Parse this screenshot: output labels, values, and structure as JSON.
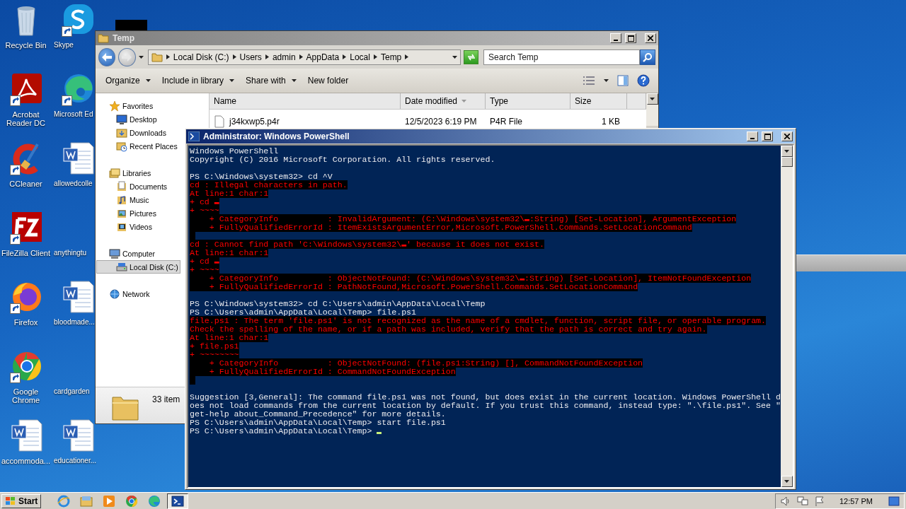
{
  "desktop_icons": [
    {
      "label": "Recycle Bin",
      "kind": "recycle"
    },
    {
      "label": "Skype",
      "kind": "skype",
      "shortcut": true
    },
    {
      "label": "Acrobat Reader DC",
      "kind": "acrobat",
      "shortcut": true
    },
    {
      "label": "Microsoft Ed",
      "kind": "edge",
      "shortcut": true
    },
    {
      "label": "CCleaner",
      "kind": "ccleaner",
      "shortcut": true
    },
    {
      "label": "allowedcolle",
      "kind": "word"
    },
    {
      "label": "FileZilla Client",
      "kind": "filezilla",
      "shortcut": true
    },
    {
      "label": "anythingtu",
      "kind": "blank"
    },
    {
      "label": "Firefox",
      "kind": "firefox",
      "shortcut": true
    },
    {
      "label": "bloodmade...",
      "kind": "word"
    },
    {
      "label": "Google Chrome",
      "kind": "chrome",
      "shortcut": true
    },
    {
      "label": "cardgarden",
      "kind": "blank"
    },
    {
      "label": "accommoda...",
      "kind": "word"
    },
    {
      "label": "educationer...",
      "kind": "word"
    }
  ],
  "explorer": {
    "title": "Temp",
    "breadcrumb": [
      "Local Disk (C:)",
      "Users",
      "admin",
      "AppData",
      "Local",
      "Temp"
    ],
    "search": {
      "placeholder": "Search Temp"
    },
    "toolbar": [
      {
        "label": "Organize",
        "dropdown": true
      },
      {
        "label": "Include in library",
        "dropdown": true
      },
      {
        "label": "Share with",
        "dropdown": true
      },
      {
        "label": "New folder",
        "dropdown": false
      }
    ],
    "nav": [
      {
        "label": "Favorites",
        "kind": "star",
        "selected": false,
        "children": [
          {
            "label": "Desktop",
            "kind": "desktop",
            "selected": false
          },
          {
            "label": "Downloads",
            "kind": "downloads",
            "selected": false
          },
          {
            "label": "Recent Places",
            "kind": "recent",
            "selected": false
          }
        ]
      },
      {
        "label": "Libraries",
        "kind": "libraries",
        "selected": false,
        "children": [
          {
            "label": "Documents",
            "kind": "documents",
            "selected": false
          },
          {
            "label": "Music",
            "kind": "music",
            "selected": false
          },
          {
            "label": "Pictures",
            "kind": "pictures",
            "selected": false
          },
          {
            "label": "Videos",
            "kind": "videos",
            "selected": false
          }
        ]
      },
      {
        "label": "Computer",
        "kind": "computer",
        "selected": false,
        "children": [
          {
            "label": "Local Disk (C:)",
            "kind": "disk",
            "selected": true
          }
        ]
      },
      {
        "label": "Network",
        "kind": "network",
        "selected": false
      }
    ],
    "columns": [
      {
        "label": "Name",
        "sorted": false
      },
      {
        "label": "Date modified",
        "sorted": true
      },
      {
        "label": "Type",
        "sorted": false
      },
      {
        "label": "Size",
        "sorted": false
      }
    ],
    "rows": [
      {
        "name": "j34kxwp5.p4r",
        "date": "12/5/2023 6:19 PM",
        "type": "P4R File",
        "size": "1 KB"
      }
    ],
    "status": "33 item"
  },
  "powershell": {
    "title": "Administrator: Windows PowerShell",
    "lines": [
      {
        "kind": "output",
        "text": "Windows PowerShell"
      },
      {
        "kind": "output",
        "text": "Copyright (C) 2016 Microsoft Corporation. All rights reserved."
      },
      {
        "kind": "blank"
      },
      {
        "kind": "output",
        "text": "PS C:\\Windows\\system32> cd ^V"
      },
      {
        "kind": "error",
        "text": "cd : Illegal characters in path."
      },
      {
        "kind": "error",
        "text": "At line:1 char:1"
      },
      {
        "kind": "error",
        "text": "+ cd ▬"
      },
      {
        "kind": "error",
        "text": "+ ~~~~"
      },
      {
        "kind": "error",
        "text": "    + CategoryInfo          : InvalidArgument: (C:\\Windows\\system32\\▬:String) [Set-Location], ArgumentException"
      },
      {
        "kind": "error",
        "text": "    + FullyQualifiedErrorId : ItemExistsArgumentError,Microsoft.PowerShell.Commands.SetLocationCommand"
      },
      {
        "kind": "gap"
      },
      {
        "kind": "error",
        "text": "cd : Cannot find path 'C:\\Windows\\system32\\▬' because it does not exist."
      },
      {
        "kind": "error",
        "text": "At line:1 char:1"
      },
      {
        "kind": "error",
        "text": "+ cd ▬"
      },
      {
        "kind": "error",
        "text": "+ ~~~~"
      },
      {
        "kind": "error",
        "text": "    + CategoryInfo          : ObjectNotFound: (C:\\Windows\\system32\\▬:String) [Set-Location], ItemNotFoundException"
      },
      {
        "kind": "error",
        "text": "    + FullyQualifiedErrorId : PathNotFound,Microsoft.PowerShell.Commands.SetLocationCommand"
      },
      {
        "kind": "blank"
      },
      {
        "kind": "output",
        "text": "PS C:\\Windows\\system32> cd C:\\Users\\admin\\AppData\\Local\\Temp"
      },
      {
        "kind": "output",
        "text": "PS C:\\Users\\admin\\AppData\\Local\\Temp> file.ps1"
      },
      {
        "kind": "error",
        "text": "file.ps1 : The term 'file.ps1' is not recognized as the name of a cmdlet, function, script file, or operable program."
      },
      {
        "kind": "error",
        "text": "Check the spelling of the name, or if a path was included, verify that the path is correct and try again."
      },
      {
        "kind": "error",
        "text": "At line:1 char:1"
      },
      {
        "kind": "error",
        "text": "+ file.ps1"
      },
      {
        "kind": "error",
        "text": "+ ~~~~~~~~"
      },
      {
        "kind": "error",
        "text": "    + CategoryInfo          : ObjectNotFound: (file.ps1:String) [], CommandNotFoundException"
      },
      {
        "kind": "error",
        "text": "    + FullyQualifiedErrorId : CommandNotFoundException"
      },
      {
        "kind": "gap"
      },
      {
        "kind": "blank"
      },
      {
        "kind": "output",
        "text": "Suggestion [3,General]: The command file.ps1 was not found, but does exist in the current location. Windows PowerShell d"
      },
      {
        "kind": "output",
        "text": "oes not load commands from the current location by default. If you trust this command, instead type: \".\\file.ps1\". See \""
      },
      {
        "kind": "output",
        "text": "get-help about_Command_Precedence\" for more details."
      },
      {
        "kind": "output",
        "text": "PS C:\\Users\\admin\\AppData\\Local\\Temp> start file.ps1"
      },
      {
        "kind": "prompt",
        "text": "PS C:\\Users\\admin\\AppData\\Local\\Temp> "
      }
    ]
  },
  "taskbar": {
    "start": "Start",
    "apps": [
      {
        "kind": "ie",
        "active": false
      },
      {
        "kind": "explorer",
        "active": false
      },
      {
        "kind": "media",
        "active": false
      },
      {
        "kind": "chrome",
        "active": false
      },
      {
        "kind": "edge",
        "active": false
      },
      {
        "kind": "powershell",
        "active": true
      }
    ],
    "clock": "12:57 PM"
  }
}
